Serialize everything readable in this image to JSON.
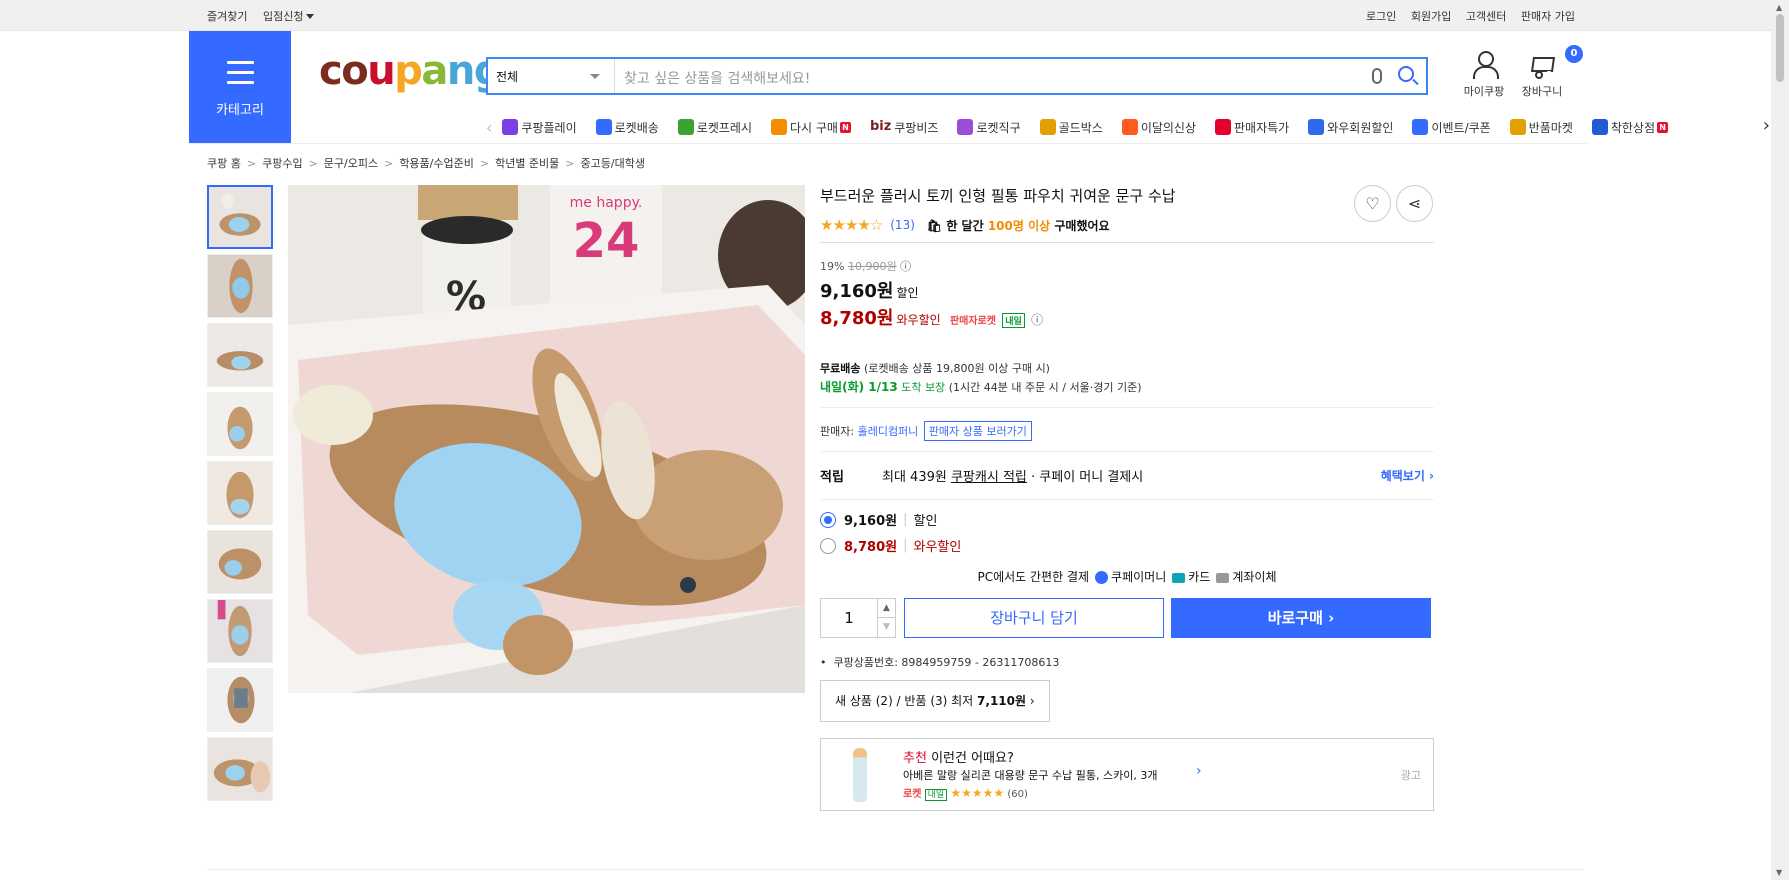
{
  "topbar": {
    "left": [
      "즐겨찾기",
      "입점신청"
    ],
    "right": [
      "로그인",
      "회원가입",
      "고객센터",
      "판매자 가입"
    ]
  },
  "header": {
    "category_label": "카테고리",
    "logo": "coupang",
    "search_select": "전체",
    "search_placeholder": "찾고 싶은 상품을 검색해보세요!",
    "mycoupang": "마이쿠팡",
    "cart": "장바구니",
    "cart_count": "0"
  },
  "nav": [
    {
      "label": "쿠팡플레이",
      "icon": "play-icon",
      "color": "#7b3fe4"
    },
    {
      "label": "로켓배송",
      "icon": "rocket-icon",
      "color": "#346aff"
    },
    {
      "label": "로켓프레시",
      "icon": "rocket-fresh-icon",
      "color": "#3aa335"
    },
    {
      "label": "다시 구매",
      "icon": "rebuy-icon",
      "color": "#f28d00",
      "new": "N"
    },
    {
      "label": "쿠팡비즈",
      "icon": "biz-icon",
      "color": "#7a1f1f",
      "prefix": "biz"
    },
    {
      "label": "로켓직구",
      "icon": "globe-rocket-icon",
      "color": "#9b4dd6"
    },
    {
      "label": "골드박스",
      "icon": "goldbox-icon",
      "color": "#e2a100"
    },
    {
      "label": "이달의신상",
      "icon": "new-arrival-icon",
      "color": "#ff5a1f"
    },
    {
      "label": "판매자특가",
      "icon": "seller-deal-icon",
      "color": "#e4002b"
    },
    {
      "label": "와우회원할인",
      "icon": "wow-icon",
      "color": "#2c6bed"
    },
    {
      "label": "이벤트/쿠폰",
      "icon": "event-coupon-icon",
      "color": "#346aff"
    },
    {
      "label": "반품마켓",
      "icon": "return-market-icon",
      "color": "#e2a100"
    },
    {
      "label": "착한상점",
      "icon": "good-store-icon",
      "color": "#1f5bd6",
      "new": "N"
    }
  ],
  "breadcrumb": [
    "쿠팡 홈",
    "쿠팡수입",
    "문구/오피스",
    "학용품/수업준비",
    "학년별 준비물",
    "중고등/대학생"
  ],
  "product": {
    "title": "부드러운 플러시 토끼 인형 필통 파우치 귀여운 문구 수납",
    "rating_count": "(13)",
    "stars": "★★★★☆",
    "bought_prefix": "한 달간",
    "bought_highlight": "100명 이상",
    "bought_suffix": "구매했어요",
    "discount_rate": "19%",
    "original_price": "10,900원",
    "sale_price": "9,160원",
    "sale_label": "할인",
    "wow_price": "8,780원",
    "wow_label": "와우할인",
    "wow_tag": "판매자로켓",
    "wow_next": "내일",
    "shipping_title": "무료배송",
    "shipping_note": "(로켓배송 상품 19,800원 이상 구매 시)",
    "delivery_date": "내일(화) 1/13",
    "delivery_label": "도착 보장",
    "delivery_note": "(1시간 44분 내 주문 시 / 서울·경기 기준)",
    "seller_label": "판매자:",
    "seller_name": "홀레디컴퍼니",
    "seller_button": "판매자 상품 보러가기",
    "points_label": "적립",
    "points_text": "최대 439원",
    "points_link": "쿠팡캐시 적립",
    "points_suffix": "· 쿠페이 머니 결제시",
    "points_more": "혜택보기",
    "option1_price": "9,160원",
    "option1_label": "할인",
    "option2_price": "8,780원",
    "option2_label": "와우할인",
    "pay_text": "PC에서도 간편한 결제",
    "pay_coupay": "쿠페이머니",
    "pay_card": "카드",
    "pay_account": "계좌이체",
    "quantity": "1",
    "add_cart": "장바구니 담기",
    "buy_now": "바로구매",
    "product_id": "쿠팡상품번호: 8984959759 - 26311708613",
    "new_return": "새 상품 (2) / 반품 (3) 최저",
    "new_return_price": "7,110원"
  },
  "recommend": {
    "title_red": "추천",
    "title": "이런건 어때요?",
    "item": "아베른 말랑 실리콘 대용량 문구 수납 필통, 스카이, 3개",
    "rocket": "로켓",
    "next": "내일",
    "stars": "★★★★★",
    "count": "(60)",
    "ad": "광고"
  }
}
